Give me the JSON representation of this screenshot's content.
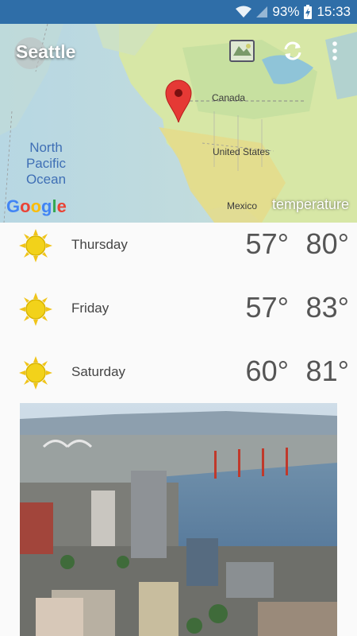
{
  "status_bar": {
    "battery": "93%",
    "time": "15:33",
    "icons": [
      "wifi-icon",
      "signal-icon",
      "battery-charging-icon"
    ]
  },
  "toolbar": {
    "city": "Seattle",
    "icons": [
      "map-layers-icon",
      "refresh-icon",
      "more-vert-icon"
    ]
  },
  "map": {
    "labels": {
      "canada": "Canada",
      "us": "United States",
      "mexico": "Mexico",
      "ocean": "North Pacific Ocean"
    },
    "attribution": "Google",
    "layer": "temperature"
  },
  "forecast": [
    {
      "day": "Thursday",
      "low": "57°",
      "high": "80°",
      "icon": "sun-icon"
    },
    {
      "day": "Friday",
      "low": "57°",
      "high": "83°",
      "icon": "sun-icon"
    },
    {
      "day": "Saturday",
      "low": "60°",
      "high": "81°",
      "icon": "sun-icon"
    }
  ],
  "colors": {
    "status_bar": "#2f6ea8",
    "sun": "#f2d21a",
    "pin": "#e53935"
  }
}
